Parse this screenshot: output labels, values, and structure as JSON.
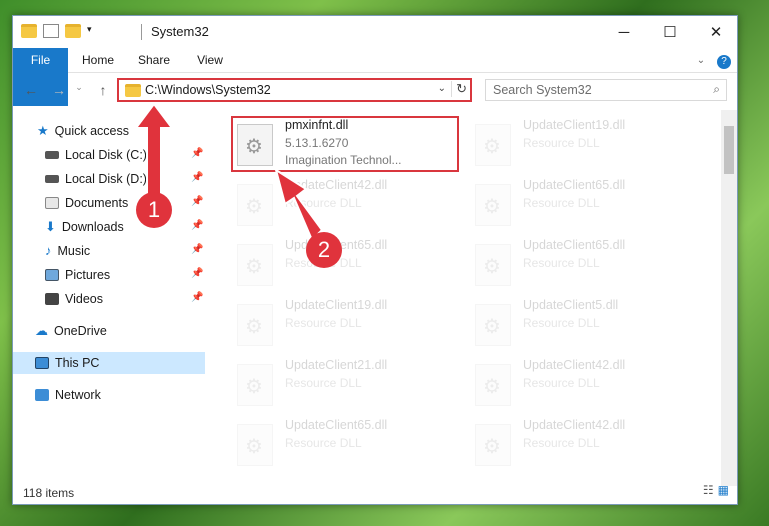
{
  "window": {
    "title": "System32",
    "minimize": "─",
    "maximize": "☐",
    "close": "✕"
  },
  "ribbon": {
    "tabs": [
      "File",
      "Home",
      "Share",
      "View"
    ]
  },
  "address": {
    "path": "C:\\Windows\\System32",
    "search_placeholder": "Search System32"
  },
  "nav": {
    "items": [
      {
        "label": "Quick access",
        "icon": "star-icon"
      },
      {
        "label": "Local Disk (C:)",
        "icon": "drive-icon",
        "pinned": true
      },
      {
        "label": "Local Disk (D:)",
        "icon": "drive-icon",
        "pinned": true
      },
      {
        "label": "Documents",
        "icon": "documents-icon",
        "pinned": true
      },
      {
        "label": "Downloads",
        "icon": "downloads-icon",
        "pinned": true
      },
      {
        "label": "Music",
        "icon": "music-icon",
        "pinned": true
      },
      {
        "label": "Pictures",
        "icon": "pictures-icon",
        "pinned": true
      },
      {
        "label": "Videos",
        "icon": "videos-icon",
        "pinned": true
      },
      {
        "label": "OneDrive",
        "icon": "cloud-icon"
      },
      {
        "label": "This PC",
        "icon": "computer-icon",
        "selected": true
      },
      {
        "label": "Network",
        "icon": "network-icon"
      }
    ]
  },
  "files": {
    "main": {
      "name": "pmxinfnt.dll",
      "version": "5.13.1.6270",
      "company": "Imagination Technol..."
    },
    "ghost_left": [
      {
        "name": "UpdateClient42.dll",
        "type": "Resource DLL"
      },
      {
        "name": "UpdateClient65.dll",
        "type": "Resource DLL"
      },
      {
        "name": "UpdateClient19.dll",
        "type": "Resource DLL"
      },
      {
        "name": "UpdateClient21.dll",
        "type": "Resource DLL"
      },
      {
        "name": "UpdateClient65.dll",
        "type": "Resource DLL"
      }
    ],
    "ghost_right": [
      {
        "name": "UpdateClient19.dll",
        "type": "Resource DLL"
      },
      {
        "name": "UpdateClient65.dll",
        "type": "Resource DLL"
      },
      {
        "name": "UpdateClient65.dll",
        "type": "Resource DLL"
      },
      {
        "name": "UpdateClient5.dll",
        "type": "Resource DLL"
      },
      {
        "name": "UpdateClient42.dll",
        "type": "Resource DLL"
      },
      {
        "name": "UpdateClient42.dll",
        "type": "Resource DLL"
      }
    ]
  },
  "status": {
    "items": "118 items"
  },
  "callouts": [
    "1",
    "2"
  ],
  "colors": {
    "accent": "#1979ca",
    "highlight": "#d9363e",
    "selection": "#cce8ff"
  }
}
